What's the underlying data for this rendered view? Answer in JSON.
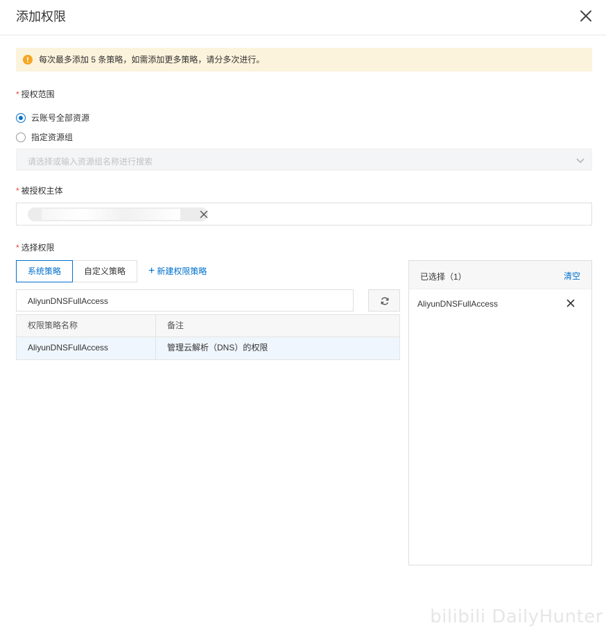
{
  "dialog": {
    "title": "添加权限"
  },
  "alert": {
    "text": "每次最多添加 5 条策略，如需添加更多策略，请分多次进行。",
    "color": "#f5a623"
  },
  "scope": {
    "label": "授权范围",
    "options": [
      {
        "label": "云账号全部资源",
        "checked": true
      },
      {
        "label": "指定资源组",
        "checked": false
      }
    ],
    "resource_group_placeholder": "请选择或输入资源组名称进行搜索"
  },
  "principal": {
    "label": "被授权主体"
  },
  "permissions": {
    "label": "选择权限",
    "tabs": [
      {
        "label": "系统策略",
        "active": true
      },
      {
        "label": "自定义策略",
        "active": false
      }
    ],
    "new_policy_label": "新建权限策略",
    "search_value": "AliyunDNSFullAccess",
    "table": {
      "columns": [
        "权限策略名称",
        "备注"
      ],
      "rows": [
        {
          "name": "AliyunDNSFullAccess",
          "note": "管理云解析（DNS）的权限"
        }
      ]
    }
  },
  "selected": {
    "title": "已选择（1）",
    "clear_label": "清空",
    "items": [
      "AliyunDNSFullAccess"
    ]
  },
  "watermark": "bilibili DailyHunter",
  "colors": {
    "primary": "#0070cc",
    "required": "#f04134",
    "alert_bg": "#fcf3dc"
  }
}
